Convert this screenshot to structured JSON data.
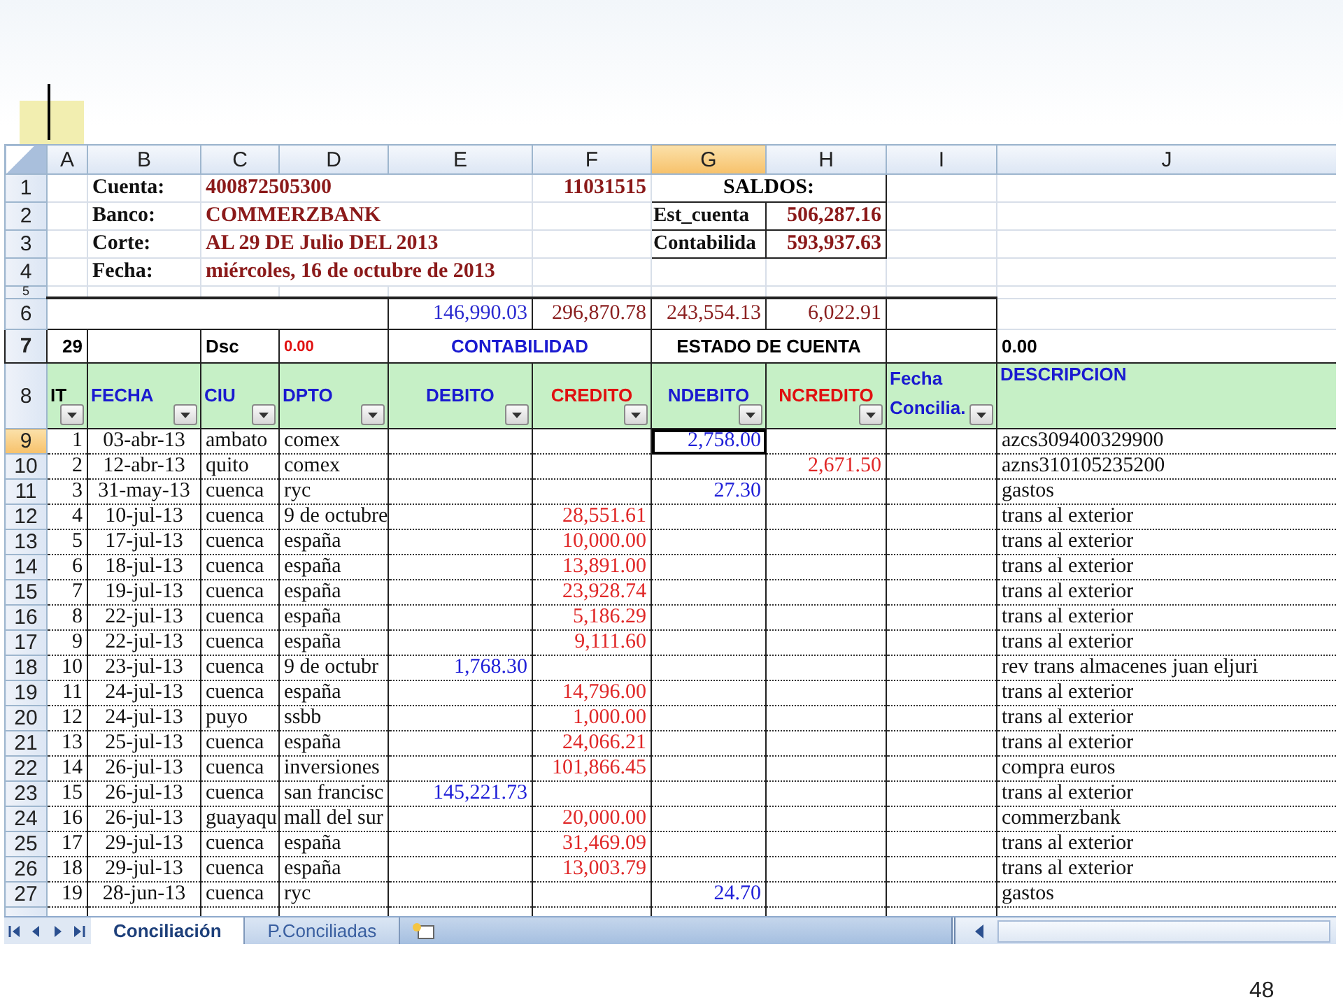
{
  "slide": {
    "page_number": "48"
  },
  "sheet": {
    "columns": [
      {
        "label": "A",
        "selected": false
      },
      {
        "label": "B",
        "selected": false
      },
      {
        "label": "C",
        "selected": false
      },
      {
        "label": "D",
        "selected": false
      },
      {
        "label": "E",
        "selected": false
      },
      {
        "label": "F",
        "selected": false
      },
      {
        "label": "G",
        "selected": true
      },
      {
        "label": "H",
        "selected": false
      },
      {
        "label": "I",
        "selected": false
      },
      {
        "label": "J",
        "selected": false
      }
    ],
    "account": [
      {
        "row": "1",
        "label": "Cuenta:",
        "value": "400872505300",
        "extra": "11031515"
      },
      {
        "row": "2",
        "label": "Banco:",
        "value": "COMMERZBANK"
      },
      {
        "row": "3",
        "label": "Corte:",
        "value": "AL 29 DE Julio DEL 2013"
      },
      {
        "row": "4",
        "label": "Fecha:",
        "value": "miércoles, 16 de octubre de 2013"
      }
    ],
    "saldos": {
      "title": "SALDOS:",
      "items": [
        {
          "label": "Est_cuenta",
          "value": "506,287.16"
        },
        {
          "label": "Contabilida",
          "value": "593,937.63"
        }
      ]
    },
    "spacer_row": "5",
    "totals": {
      "row": "6",
      "values": [
        {
          "value": "146,990.03",
          "color": "#2b2bd0"
        },
        {
          "value": "296,870.78",
          "color": "#8b2020"
        },
        {
          "value": "243,554.13",
          "color": "#8b2020"
        },
        {
          "value": "6,022.91",
          "color": "#8b2020"
        }
      ]
    },
    "groups": {
      "row": "7",
      "count": "29",
      "dsc_label": "Dsc",
      "dsc_value": "0.00",
      "contabilidad": "CONTABILIDAD",
      "estado": "ESTADO DE CUENTA",
      "balance": "0.00"
    },
    "headers": {
      "row": "8",
      "items": [
        {
          "label": "IT",
          "color": "#000000"
        },
        {
          "label": "FECHA",
          "color": "#1a1ad0"
        },
        {
          "label": "CIU",
          "color": "#1a1ad0"
        },
        {
          "label": "DPTO",
          "color": "#1a1ad0"
        },
        {
          "label": "DEBITO",
          "color": "#1a1ad0"
        },
        {
          "label": "CREDITO",
          "color": "#e01010"
        },
        {
          "label": "NDEBITO",
          "color": "#1a1ad0"
        },
        {
          "label": "NCREDITO",
          "color": "#e01010"
        },
        {
          "label": "Fecha Concilia.",
          "color": "#1a1ad0"
        },
        {
          "label": "DESCRIPCION",
          "color": "#1a1ad0"
        }
      ]
    },
    "rows": [
      {
        "row": "9",
        "selected": true,
        "it": "1",
        "fecha": "03-abr-13",
        "ciu": "ambato",
        "dpto": "comex",
        "ndebito": "2,758.00",
        "descripcion": "azcs309400329900"
      },
      {
        "row": "10",
        "selected": false,
        "it": "2",
        "fecha": "12-abr-13",
        "ciu": "quito",
        "dpto": "comex",
        "ncredito": "2,671.50",
        "descripcion": "azns310105235200"
      },
      {
        "row": "11",
        "selected": false,
        "it": "3",
        "fecha": "31-may-13",
        "ciu": "cuenca",
        "dpto": "ryc",
        "ndebito": "27.30",
        "descripcion": "gastos"
      },
      {
        "row": "12",
        "selected": false,
        "it": "4",
        "fecha": "10-jul-13",
        "ciu": "cuenca",
        "dpto": "9 de octubre",
        "credito": "28,551.61",
        "descripcion": "trans al exterior"
      },
      {
        "row": "13",
        "selected": false,
        "it": "5",
        "fecha": "17-jul-13",
        "ciu": "cuenca",
        "dpto": "españa",
        "credito": "10,000.00",
        "descripcion": "trans al exterior"
      },
      {
        "row": "14",
        "selected": false,
        "it": "6",
        "fecha": "18-jul-13",
        "ciu": "cuenca",
        "dpto": "españa",
        "credito": "13,891.00",
        "descripcion": "trans al exterior"
      },
      {
        "row": "15",
        "selected": false,
        "it": "7",
        "fecha": "19-jul-13",
        "ciu": "cuenca",
        "dpto": "españa",
        "credito": "23,928.74",
        "descripcion": "trans al exterior"
      },
      {
        "row": "16",
        "selected": false,
        "it": "8",
        "fecha": "22-jul-13",
        "ciu": "cuenca",
        "dpto": "españa",
        "credito": "5,186.29",
        "descripcion": "trans al exterior"
      },
      {
        "row": "17",
        "selected": false,
        "it": "9",
        "fecha": "22-jul-13",
        "ciu": "cuenca",
        "dpto": "españa",
        "credito": "9,111.60",
        "descripcion": "trans al exterior"
      },
      {
        "row": "18",
        "selected": false,
        "it": "10",
        "fecha": "23-jul-13",
        "ciu": "cuenca",
        "dpto": "9 de octubr",
        "debito": "1,768.30",
        "descripcion": "rev trans almacenes juan eljuri"
      },
      {
        "row": "19",
        "selected": false,
        "it": "11",
        "fecha": "24-jul-13",
        "ciu": "cuenca",
        "dpto": "españa",
        "credito": "14,796.00",
        "descripcion": "trans al exterior"
      },
      {
        "row": "20",
        "selected": false,
        "it": "12",
        "fecha": "24-jul-13",
        "ciu": "puyo",
        "dpto": "ssbb",
        "credito": "1,000.00",
        "descripcion": "trans al exterior"
      },
      {
        "row": "21",
        "selected": false,
        "it": "13",
        "fecha": "25-jul-13",
        "ciu": "cuenca",
        "dpto": "españa",
        "credito": "24,066.21",
        "descripcion": "trans al exterior"
      },
      {
        "row": "22",
        "selected": false,
        "it": "14",
        "fecha": "26-jul-13",
        "ciu": "cuenca",
        "dpto": "inversiones",
        "credito": "101,866.45",
        "descripcion": "compra euros"
      },
      {
        "row": "23",
        "selected": false,
        "it": "15",
        "fecha": "26-jul-13",
        "ciu": "cuenca",
        "dpto": "san francisc",
        "debito": "145,221.73",
        "descripcion": "trans al exterior"
      },
      {
        "row": "24",
        "selected": false,
        "it": "16",
        "fecha": "26-jul-13",
        "ciu": "guayaqu",
        "dpto": "mall del sur",
        "credito": "20,000.00",
        "descripcion": "commerzbank"
      },
      {
        "row": "25",
        "selected": false,
        "it": "17",
        "fecha": "29-jul-13",
        "ciu": "cuenca",
        "dpto": "españa",
        "credito": "31,469.09",
        "descripcion": "trans al exterior"
      },
      {
        "row": "26",
        "selected": false,
        "it": "18",
        "fecha": "29-jul-13",
        "ciu": "cuenca",
        "dpto": "españa",
        "credito": "13,003.79",
        "descripcion": "trans al exterior"
      },
      {
        "row": "27",
        "selected": false,
        "it": "19",
        "fecha": "28-jun-13",
        "ciu": "cuenca",
        "dpto": "ryc",
        "ndebito": "24.70",
        "descripcion": "gastos"
      }
    ],
    "sheet_tabs": [
      {
        "label": "Conciliación",
        "selected": true
      },
      {
        "label": "P.Conciliadas",
        "selected": false
      }
    ]
  }
}
